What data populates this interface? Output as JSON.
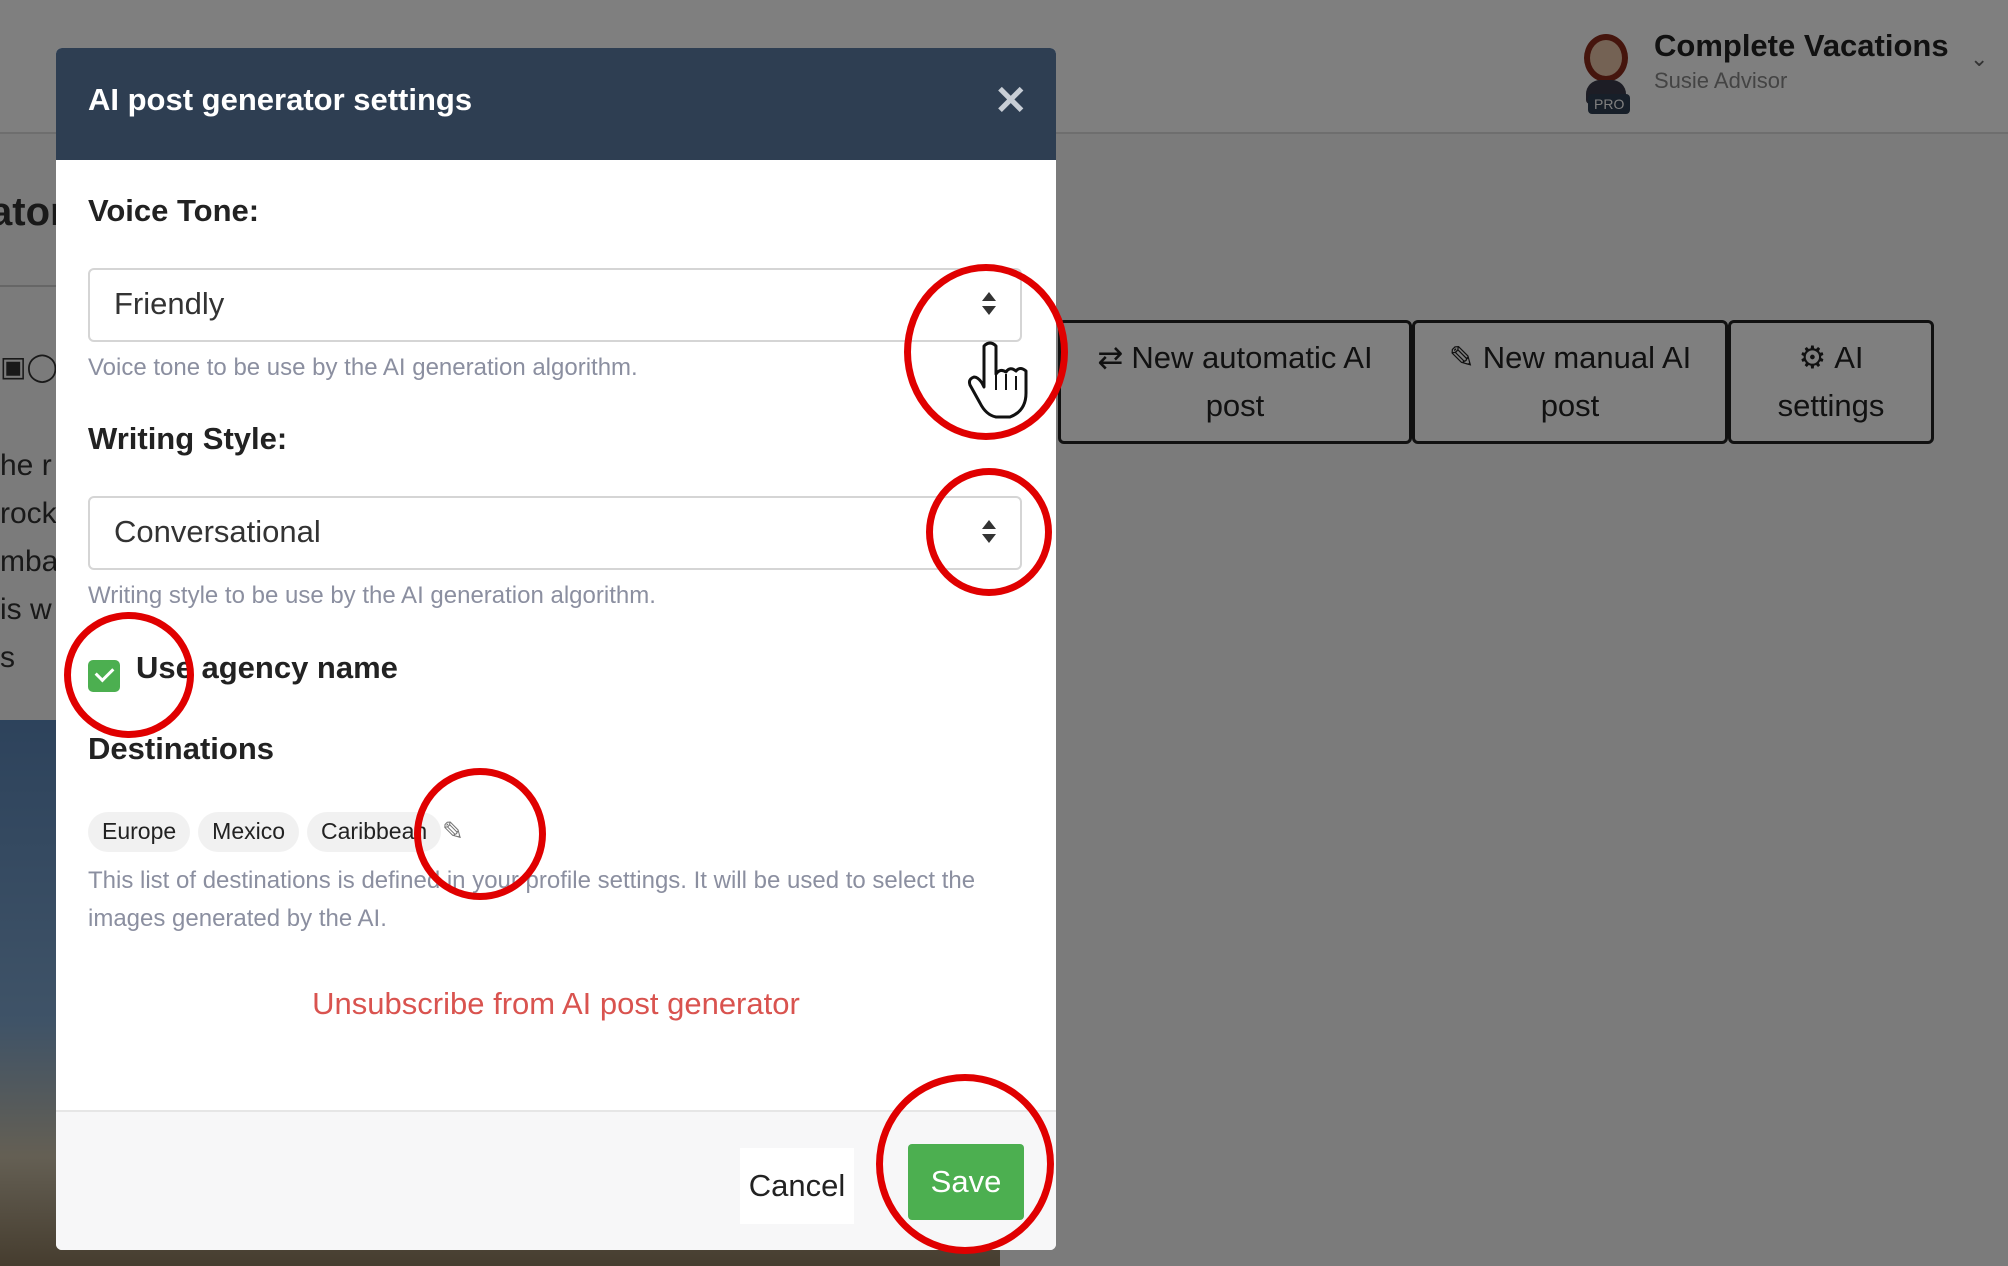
{
  "header": {
    "account_name": "Complete Vacations",
    "account_user": "Susie Advisor",
    "badge": "PRO",
    "chevron": "chevron-down-icon"
  },
  "background": {
    "page_title_fragment": "ator",
    "social_icons": [
      "facebook-icon",
      "instagram-icon"
    ],
    "text_fragments": [
      "he r",
      "rock",
      "mbar",
      "is w",
      "s"
    ],
    "actions": [
      {
        "icon": "shuffle-icon",
        "label": "New automatic AI post"
      },
      {
        "icon": "pencil-icon",
        "label": "New manual AI post"
      },
      {
        "icon": "gear-icon",
        "label": "AI settings"
      }
    ]
  },
  "modal": {
    "title": "AI post generator settings",
    "close_icon": "close-icon",
    "voice_tone": {
      "label": "Voice Tone:",
      "value": "Friendly",
      "help": "Voice tone to be use by the AI generation algorithm."
    },
    "writing_style": {
      "label": "Writing Style:",
      "value": "Conversational",
      "help": "Writing style to be use by the AI generation algorithm."
    },
    "use_agency_name": {
      "label": "Use agency name",
      "checked": true
    },
    "destinations": {
      "label": "Destinations",
      "tags": [
        "Europe",
        "Mexico",
        "Caribbean"
      ],
      "help": "This list of destinations is defined in your profile settings. It will be used to select the images generated by the AI."
    },
    "unsubscribe": "Unsubscribe from AI post generator",
    "cancel": "Cancel",
    "save": "Save"
  },
  "colors": {
    "modal_header": "#2e3e52",
    "save_button": "#4caf50",
    "checkbox": "#4caf50",
    "unsubscribe": "#d9534f",
    "annotation_ring": "#e00000"
  }
}
